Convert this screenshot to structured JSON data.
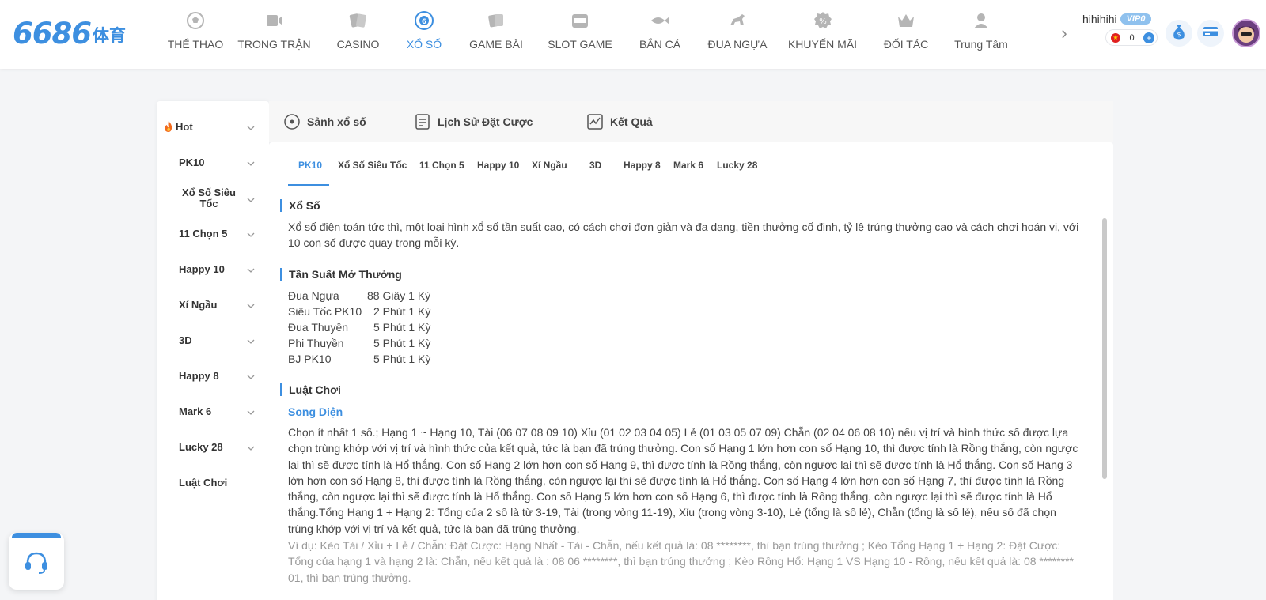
{
  "header": {
    "logo_number": "6686",
    "logo_text": "体育",
    "nav": [
      {
        "label": "THỂ THAO",
        "icon": "soccer-ball-icon",
        "active": false
      },
      {
        "label": "TRONG TRẬN",
        "icon": "live-video-icon",
        "active": false
      },
      {
        "label": "CASINO",
        "icon": "playing-cards-icon",
        "active": false
      },
      {
        "label": "XỔ SỐ",
        "icon": "lottery-ball-icon",
        "active": true
      },
      {
        "label": "GAME BÀI",
        "icon": "card-game-icon",
        "active": false
      },
      {
        "label": "SLOT GAME",
        "icon": "slot-machine-icon",
        "active": false
      },
      {
        "label": "BẮN CÁ",
        "icon": "fish-icon",
        "active": false
      },
      {
        "label": "ĐUA NGỰA",
        "icon": "horse-racing-icon",
        "active": false
      },
      {
        "label": "KHUYẾN MÃI",
        "icon": "promotion-icon",
        "active": false
      },
      {
        "label": "ĐỐI TÁC",
        "icon": "partner-crown-icon",
        "active": false
      },
      {
        "label": "Trung Tâm",
        "icon": "user-center-icon",
        "active": false
      }
    ],
    "username": "hihihihi",
    "vip": "VIP0",
    "balance": "0"
  },
  "sidebar": {
    "items": [
      {
        "label": "Hot"
      },
      {
        "label": "PK10"
      },
      {
        "label": "Xổ Số Siêu Tốc"
      },
      {
        "label": "11 Chọn 5"
      },
      {
        "label": "Happy 10"
      },
      {
        "label": "Xí Ngầu"
      },
      {
        "label": "3D"
      },
      {
        "label": "Happy 8"
      },
      {
        "label": "Mark 6"
      },
      {
        "label": "Lucky 28"
      },
      {
        "label": "Luật Chơi"
      }
    ]
  },
  "top_tabs": [
    {
      "label": "Sảnh xổ số"
    },
    {
      "label": "Lịch Sử Đặt Cược"
    },
    {
      "label": "Kết Quả"
    }
  ],
  "sub_tabs": [
    "PK10",
    "Xổ Số Siêu Tốc",
    "11 Chọn 5",
    "Happy 10",
    "Xí Ngầu",
    "3D",
    "Happy 8",
    "Mark 6",
    "Lucky 28"
  ],
  "content": {
    "section1_title": "Xổ Số",
    "section1_text": "Xổ số điện toán tức thì, một loại hình xổ số tần suất cao, có cách chơi đơn giản và đa dạng, tiền thưởng cố định, tỷ lệ trúng thưởng cao và cách chơi hoán vị, với 10 con số được quay trong mỗi kỳ.",
    "section2_title": "Tần Suất Mở Thưởng",
    "frequency": [
      {
        "name": "Đua Ngựa",
        "value": "88 Giây 1 Kỳ"
      },
      {
        "name": "Siêu Tốc PK10",
        "value": "2 Phút 1 Kỳ"
      },
      {
        "name": "Đua Thuyền",
        "value": "5 Phút 1 Kỳ"
      },
      {
        "name": "Phi Thuyền",
        "value": "5 Phút 1 Kỳ"
      },
      {
        "name": "BJ PK10",
        "value": "5 Phút 1 Kỳ"
      }
    ],
    "section3_title": "Luật Chơi",
    "rule_title": "Song Diện",
    "rule_text": "Chọn ít nhất 1 số.; Hạng 1 ~ Hạng 10, Tài (06 07 08 09 10) Xỉu (01 02 03 04 05) Lẻ (01 03 05 07 09) Chẵn (02 04 06 08 10) nếu vị trí và hình thức số được lựa chọn trùng khớp với vị trí và hình thức của kết quả, tức là bạn đã trúng thưởng. Con số Hạng 1 lớn hơn con số Hạng 10, thì được tính là Rồng thắng, còn ngược lại thì sẽ được tính là Hổ thắng. Con số Hạng 2 lớn hơn con số Hạng 9, thì được tính là Rồng thắng, còn ngược lại thì sẽ được tính là Hổ thắng. Con số Hạng 3 lớn hơn con số Hạng 8, thì được tính là Rồng thắng, còn ngược lại thì sẽ được tính là Hổ thắng. Con số Hạng 4 lớn hơn con số Hạng 7, thì được tính là Rồng thắng, còn ngược lại thì sẽ được tính là Hổ thắng. Con số Hạng 5 lớn hơn con số Hạng 6, thì được tính là Rồng thắng, còn ngược lại thì sẽ được tính là Hổ thắng.Tổng Hạng 1 + Hạng 2: Tổng của 2 số là từ 3-19, Tài (trong vòng 11-19), Xỉu (trong vòng 3-10), Lẻ (tổng là số lẻ), Chẵn (tổng là số lẻ), nếu số đã chọn trùng khớp với vị trí và kết quả, tức là bạn đã trúng thưởng.",
    "example_text": "Ví dụ: Kèo Tài / Xỉu + Lẻ / Chẵn: Đặt Cược: Hạng Nhất - Tài - Chẵn, nếu kết quả là: 08 ********, thì bạn trúng thưởng ; Kèo Tổng Hạng 1 + Hạng 2: Đặt Cược: Tổng của hạng 1 và hạng 2 là: Chẵn, nếu kết quả là : 08 06 ********, thì bạn trúng thưởng ; Kèo Rồng Hổ: Hạng 1 VS Hạng 10 - Rồng, nếu kết quả là: 08 ******** 01, thì bạn trúng thưởng."
  },
  "colors": {
    "accent": "#3d8fe0",
    "text": "#333333",
    "muted": "#999999"
  }
}
